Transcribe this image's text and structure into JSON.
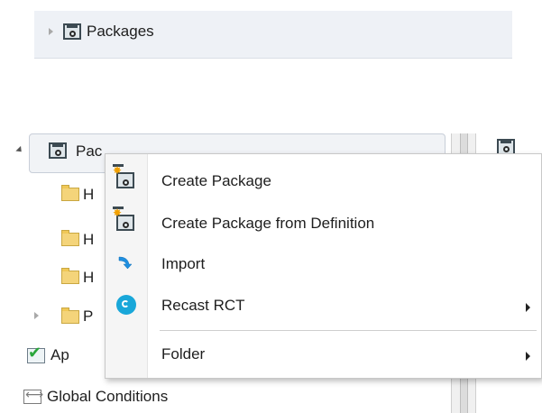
{
  "top_item": {
    "label": "Packages"
  },
  "tree": {
    "selected_label_visible": "Pac",
    "items": [
      {
        "label_visible": "H"
      },
      {
        "label_visible": "H"
      },
      {
        "label_visible": "H"
      },
      {
        "label_visible": "P"
      },
      {
        "label_visible": "Ap"
      },
      {
        "label": "Global Conditions"
      }
    ]
  },
  "context_menu": {
    "items": [
      {
        "label": "Create Package",
        "icon": "package-new-icon"
      },
      {
        "label": "Create Package from Definition",
        "icon": "package-definition-icon"
      },
      {
        "label": "Import",
        "icon": "import-icon"
      },
      {
        "label": "Recast RCT",
        "icon": "recast-icon",
        "has_submenu": true
      },
      {
        "label": "Folder",
        "icon": "",
        "has_submenu": true
      }
    ]
  }
}
